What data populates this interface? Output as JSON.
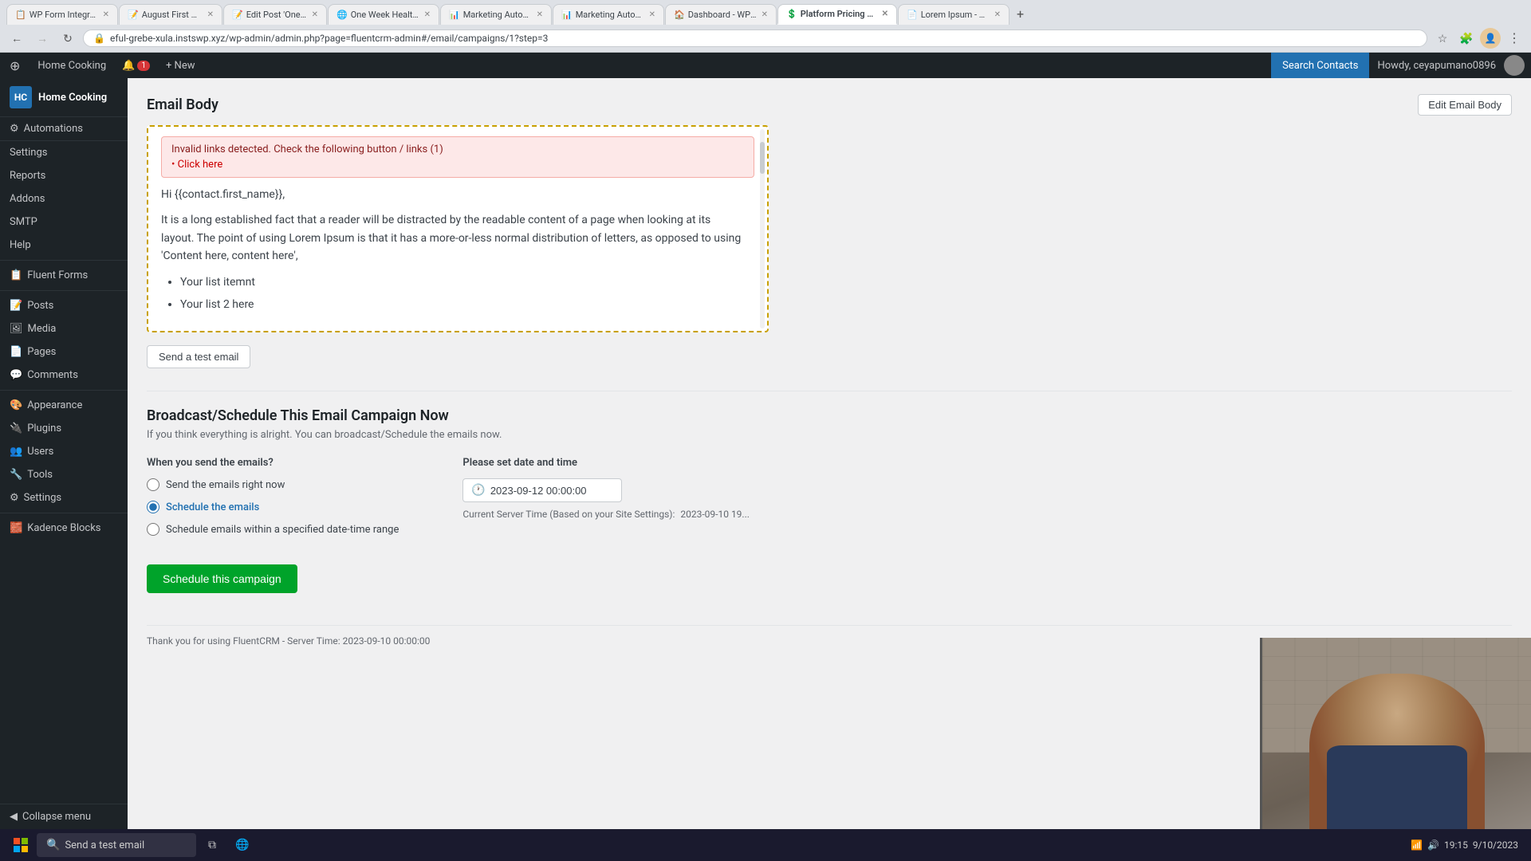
{
  "browser": {
    "tabs": [
      {
        "label": "WP Form Integrations",
        "active": false,
        "favicon": "📋"
      },
      {
        "label": "August First Week -",
        "active": false,
        "favicon": "📝"
      },
      {
        "label": "Edit Post 'One Wee...",
        "active": false,
        "favicon": "📝"
      },
      {
        "label": "One Week Healthy -",
        "active": false,
        "favicon": "🌐"
      },
      {
        "label": "Marketing Automati...",
        "active": false,
        "favicon": "📊"
      },
      {
        "label": "Marketing Automati...",
        "active": false,
        "favicon": "📊"
      },
      {
        "label": "Dashboard - WP Ma...",
        "active": false,
        "favicon": "🏠"
      },
      {
        "label": "Platform Pricing & F...",
        "active": true,
        "favicon": "💲"
      },
      {
        "label": "Lorem Ipsum - All th...",
        "active": false,
        "favicon": "📄"
      }
    ],
    "url": "eful-grebe-xula.instswp.xyz/wp-admin/admin.php?page=fluentcrm-admin#/email/campaigns/1?step=3"
  },
  "admin_bar": {
    "items": [
      {
        "label": "⊕",
        "icon": "wp-icon"
      },
      {
        "label": "Home Cooking"
      },
      {
        "label": "🔔 1",
        "badge": "1"
      },
      {
        "label": "+ New"
      }
    ],
    "search_contacts": "Search Contacts",
    "howdy": "Howdy, ceyapumano0896"
  },
  "sidebar": {
    "logo": "Home Cooking",
    "items": [
      {
        "label": "Automations",
        "icon": "⚙",
        "active": false,
        "indent": 0
      },
      {
        "label": "Settings",
        "icon": "",
        "active": false,
        "indent": 0
      },
      {
        "label": "Reports",
        "icon": "📊",
        "active": false,
        "indent": 0
      },
      {
        "label": "Addons",
        "icon": "➕",
        "active": false,
        "indent": 0
      },
      {
        "label": "SMTP",
        "icon": "✉",
        "active": false,
        "indent": 0
      },
      {
        "label": "Help",
        "icon": "❓",
        "active": false,
        "indent": 0
      },
      {
        "label": "Fluent Forms",
        "icon": "📋",
        "active": false,
        "indent": 0
      },
      {
        "label": "Posts",
        "icon": "📝",
        "active": false,
        "indent": 0
      },
      {
        "label": "Media",
        "icon": "🖼",
        "active": false,
        "indent": 0
      },
      {
        "label": "Pages",
        "icon": "📄",
        "active": false,
        "indent": 0
      },
      {
        "label": "Comments",
        "icon": "💬",
        "active": false,
        "indent": 0
      },
      {
        "label": "Appearance",
        "icon": "🎨",
        "active": false,
        "indent": 0
      },
      {
        "label": "Plugins",
        "icon": "🔌",
        "active": false,
        "indent": 0
      },
      {
        "label": "Users",
        "icon": "👥",
        "active": false,
        "indent": 0
      },
      {
        "label": "Tools",
        "icon": "🔧",
        "active": false,
        "indent": 0
      },
      {
        "label": "Settings",
        "icon": "⚙",
        "active": false,
        "indent": 0
      },
      {
        "label": "Kadence Blocks",
        "icon": "🧱",
        "active": false,
        "indent": 0
      }
    ],
    "collapse_label": "Collapse menu"
  },
  "main": {
    "email_body_section": {
      "title": "Email Body",
      "edit_button_label": "Edit Email Body",
      "invalid_links_banner": "Invalid links detected. Check the following button / links (1)",
      "invalid_links_item": "• Click here",
      "email_greeting": "Hi {{contact.first_name}},",
      "email_paragraph": "It is a long established fact that a reader will be distracted by the readable content of a page when looking at its layout. The point of using Lorem Ipsum is that it has a more-or-less normal distribution of letters, as opposed to using 'Content here, content here',",
      "list_item_1": "Your list itemnt",
      "list_item_2": "Your list 2 here",
      "send_test_button": "Send a test email"
    },
    "broadcast_section": {
      "title": "Broadcast/Schedule This Email Campaign Now",
      "description": "If you think everything is alright. You can broadcast/Schedule the emails now.",
      "when_label": "When you send the emails?",
      "radio_options": [
        {
          "label": "Send the emails right now",
          "value": "now",
          "selected": false
        },
        {
          "label": "Schedule the emails",
          "value": "schedule",
          "selected": true
        },
        {
          "label": "Schedule emails within a specified date-time range",
          "value": "range",
          "selected": false
        }
      ],
      "date_time_label": "Please set date and time",
      "date_time_value": "2023-09-12 00:00:00",
      "server_time_note": "Current Server Time (Based on your Site Settings):",
      "server_time_value": "2023-09-10 19...",
      "schedule_button": "Schedule this campaign"
    }
  },
  "footer": {
    "text": "Thank you for using FluentCRM - Server Time: 2023-09-10 00:00:00"
  },
  "colors": {
    "primary": "#2271b1",
    "success": "#00a32a",
    "danger": "#d63638",
    "warning_border": "#c8a000",
    "warning_bg": "#fffbe5"
  }
}
